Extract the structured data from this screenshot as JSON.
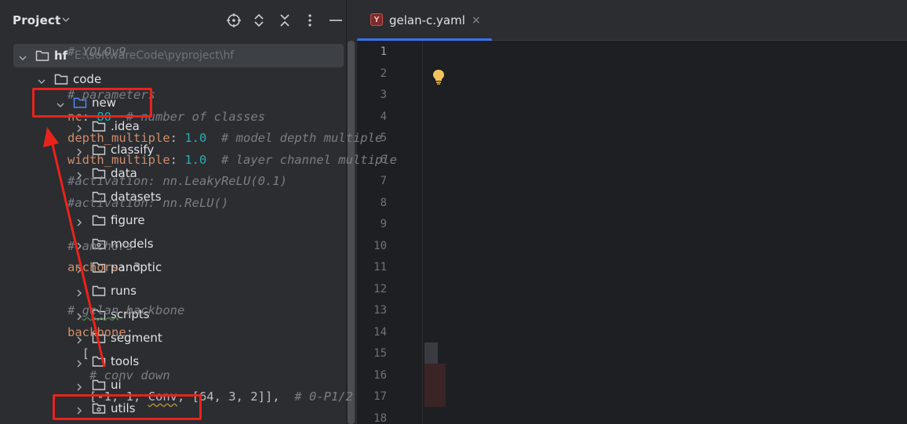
{
  "project_panel": {
    "title": "Project",
    "header_icons": [
      "locate-icon",
      "expand-collapse-icon",
      "collapse-all-icon",
      "more-icon",
      "minimize-icon"
    ]
  },
  "tree": [
    {
      "label": "hf",
      "path": "E:\\softwareCode\\pyproject\\hf",
      "depth": 0,
      "expanded": true,
      "bold": true,
      "selected": true,
      "icon": "folder-icon"
    },
    {
      "label": "code",
      "depth": 1,
      "expanded": true,
      "icon": "folder-icon"
    },
    {
      "label": "new",
      "depth": 2,
      "expanded": true,
      "icon": "folder-blue-icon"
    },
    {
      "label": ".idea",
      "depth": 3,
      "expanded": false,
      "icon": "folder-icon"
    },
    {
      "label": "classify",
      "depth": 3,
      "expanded": false,
      "icon": "folder-icon"
    },
    {
      "label": "data",
      "depth": 3,
      "expanded": false,
      "icon": "folder-icon"
    },
    {
      "label": "datasets",
      "depth": 3,
      "leaf": true,
      "icon": "folder-icon"
    },
    {
      "label": "figure",
      "depth": 3,
      "expanded": false,
      "icon": "folder-icon"
    },
    {
      "label": "models",
      "depth": 3,
      "expanded": false,
      "icon": "package-folder-icon"
    },
    {
      "label": "panoptic",
      "depth": 3,
      "expanded": false,
      "icon": "folder-icon"
    },
    {
      "label": "runs",
      "depth": 3,
      "expanded": false,
      "icon": "folder-icon"
    },
    {
      "label": "scripts",
      "depth": 3,
      "expanded": false,
      "icon": "folder-icon"
    },
    {
      "label": "segment",
      "depth": 3,
      "expanded": false,
      "icon": "folder-icon"
    },
    {
      "label": "tools",
      "depth": 3,
      "expanded": false,
      "icon": "folder-icon"
    },
    {
      "label": "ui",
      "depth": 3,
      "expanded": false,
      "icon": "folder-icon"
    },
    {
      "label": "utils",
      "depth": 3,
      "expanded": false,
      "icon": "package-folder-icon"
    }
  ],
  "editor": {
    "tab": {
      "label": "gelan-c.yaml",
      "icon": "yaml-file-icon",
      "close": "×"
    },
    "line_numbers": [
      "1",
      "2",
      "3",
      "4",
      "5",
      "6",
      "7",
      "8",
      "9",
      "10",
      "11",
      "12",
      "13",
      "14",
      "15",
      "16",
      "17",
      "18"
    ],
    "lines": [
      [
        {
          "t": "# YOLOv9",
          "c": "comment"
        }
      ],
      [],
      [
        {
          "t": "# parameters",
          "c": "comment"
        }
      ],
      [
        {
          "t": "nc",
          "c": "key"
        },
        {
          "t": ": ",
          "c": "plain"
        },
        {
          "t": "80",
          "c": "num"
        },
        {
          "t": "  # number of classes",
          "c": "comment"
        }
      ],
      [
        {
          "t": "depth_multiple",
          "c": "key"
        },
        {
          "t": ": ",
          "c": "plain"
        },
        {
          "t": "1.0",
          "c": "num"
        },
        {
          "t": "  # model depth multiple",
          "c": "comment"
        }
      ],
      [
        {
          "t": "width_multiple",
          "c": "key"
        },
        {
          "t": ": ",
          "c": "plain"
        },
        {
          "t": "1.0",
          "c": "num"
        },
        {
          "t": "  # layer channel multiple",
          "c": "comment"
        }
      ],
      [
        {
          "t": "#activation: nn.LeakyReLU(0.1)",
          "c": "comment"
        }
      ],
      [
        {
          "t": "#activation: nn.ReLU()",
          "c": "comment"
        }
      ],
      [],
      [
        {
          "t": "# anchors",
          "c": "comment"
        }
      ],
      [
        {
          "t": "anchors",
          "c": "key"
        },
        {
          "t": ": ",
          "c": "plain"
        },
        {
          "t": "3",
          "c": "plain"
        }
      ],
      [],
      [
        {
          "t": "# ",
          "c": "comment"
        },
        {
          "t": "gelan",
          "c": "comment wavy"
        },
        {
          "t": " backbone",
          "c": "comment"
        }
      ],
      [
        {
          "t": "backbone",
          "c": "key"
        },
        {
          "t": ":",
          "c": "plain"
        }
      ],
      [
        {
          "t": "  [",
          "c": "plain"
        }
      ],
      [
        {
          "t": "   # conv down",
          "c": "comment"
        }
      ],
      [
        {
          "t": "   [-1, 1, ",
          "c": "plain"
        },
        {
          "t": "Conv",
          "c": "plain wavyy"
        },
        {
          "t": ", [64, 3, 2]],  ",
          "c": "plain"
        },
        {
          "t": "# 0-P1/2",
          "c": "comment"
        }
      ],
      []
    ]
  },
  "colors": {
    "annotation": "#e8231c",
    "accent": "#3574f0"
  }
}
